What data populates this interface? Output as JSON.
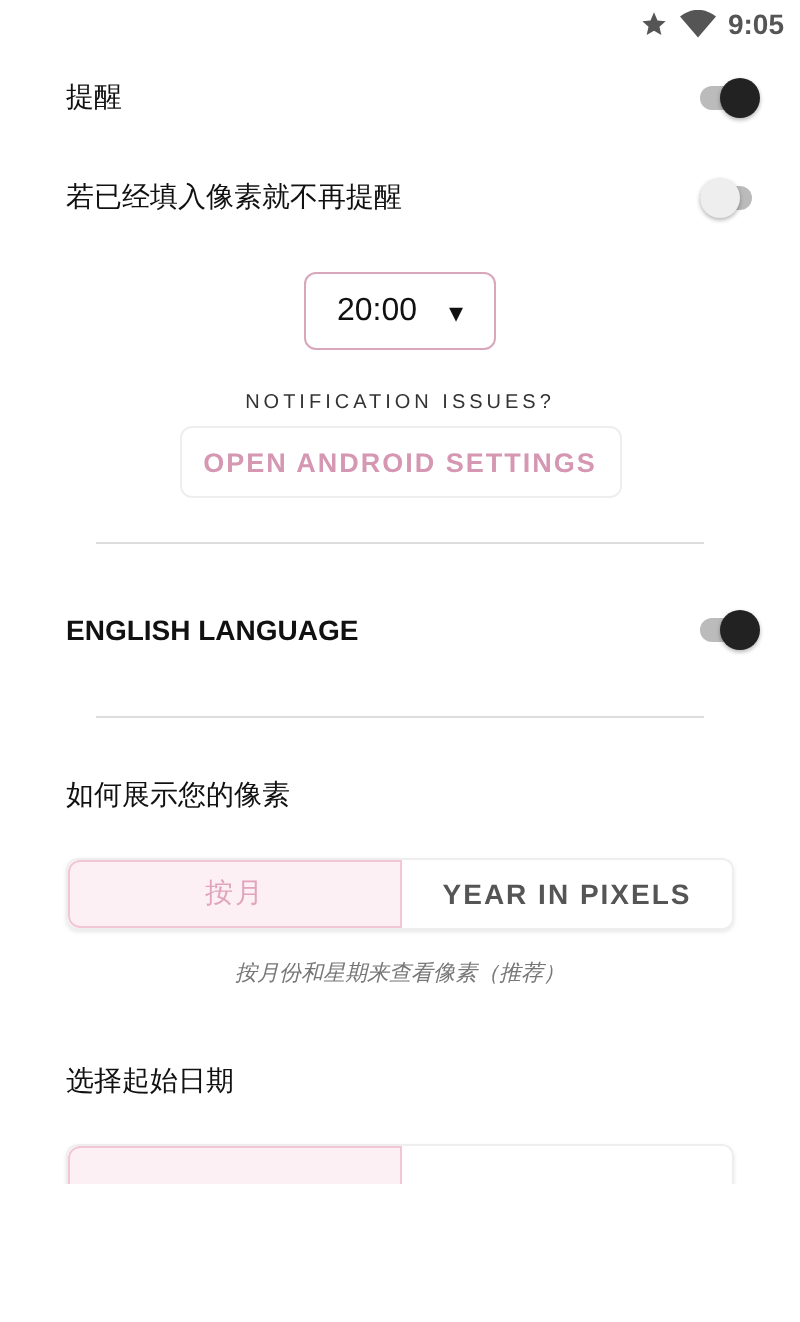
{
  "status_bar": {
    "time": "9:05"
  },
  "reminder": {
    "label": "提醒",
    "on": true
  },
  "skip_if_filled": {
    "label": "若已经填入像素就不再提醒",
    "on": false
  },
  "time_dropdown": {
    "value": "20:00",
    "icon": "▾"
  },
  "notification_issues": {
    "label": "NOTIFICATION ISSUES?",
    "button": "OPEN ANDROID SETTINGS"
  },
  "english_language": {
    "label": "ENGLISH LANGUAGE",
    "on": true
  },
  "display_mode": {
    "title": "如何展示您的像素",
    "options": [
      {
        "label": "按月",
        "selected": true
      },
      {
        "label": "YEAR IN PIXELS",
        "selected": false
      }
    ],
    "caption": "按月份和星期来查看像素（推荐）"
  },
  "start_date": {
    "title": "选择起始日期",
    "options": [
      {
        "selected": true
      },
      {
        "selected": false
      }
    ]
  }
}
